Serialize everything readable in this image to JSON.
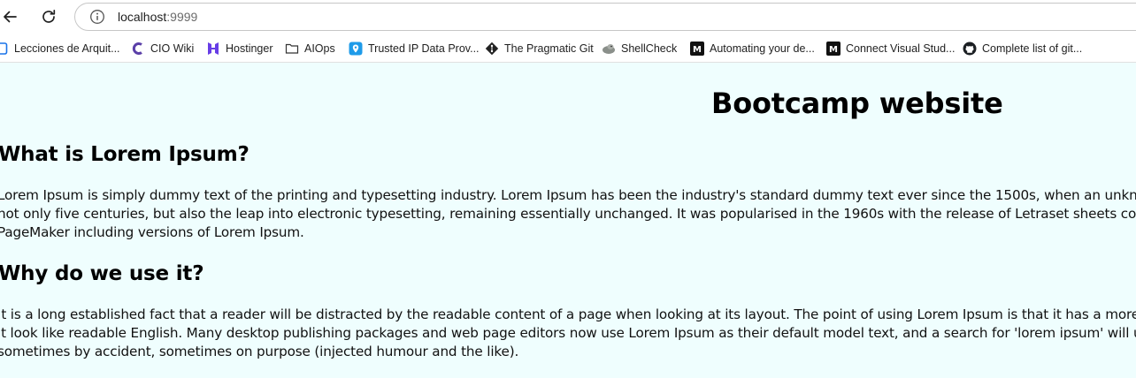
{
  "browser": {
    "url_host": "localhost",
    "url_port": ":9999"
  },
  "bookmarks": [
    {
      "label": "Lecciones de Arquit...",
      "icon": "page-icon"
    },
    {
      "label": "CIO Wiki",
      "icon": "cio-wiki-icon"
    },
    {
      "label": "Hostinger",
      "icon": "hostinger-icon"
    },
    {
      "label": "AIOps",
      "icon": "folder-icon"
    },
    {
      "label": "Trusted IP Data Prov...",
      "icon": "location-pin-icon"
    },
    {
      "label": "The Pragmatic Git",
      "icon": "git-icon"
    },
    {
      "label": "ShellCheck",
      "icon": "shellcheck-icon"
    },
    {
      "label": "Automating your de...",
      "icon": "medium-icon"
    },
    {
      "label": "Connect Visual Stud...",
      "icon": "medium-icon"
    },
    {
      "label": "Complete list of git...",
      "icon": "github-icon"
    }
  ],
  "page": {
    "title": "Bootcamp website",
    "sections": [
      {
        "heading": "What is Lorem Ipsum?",
        "lines": [
          "Lorem Ipsum is simply dummy text of the printing and typesetting industry. Lorem Ipsum has been the industry's standard dummy text ever since the 1500s, when an unknown printer",
          "not only five centuries, but also the leap into electronic typesetting, remaining essentially unchanged. It was popularised in the 1960s with the release of Letraset sheets containing Lore",
          "PageMaker including versions of Lorem Ipsum."
        ]
      },
      {
        "heading": "Why do we use it?",
        "lines": [
          "It is a long established fact that a reader will be distracted by the readable content of a page when looking at its layout. The point of using Lorem Ipsum is that it has a more-or-less no",
          "it look like readable English. Many desktop publishing packages and web page editors now use Lorem Ipsum as their default model text, and a search for 'lorem ipsum' will uncover ma",
          "sometimes by accident, sometimes on purpose (injected humour and the like)."
        ]
      }
    ]
  },
  "colors": {
    "page_background": "#effefe",
    "text": "#000000"
  }
}
